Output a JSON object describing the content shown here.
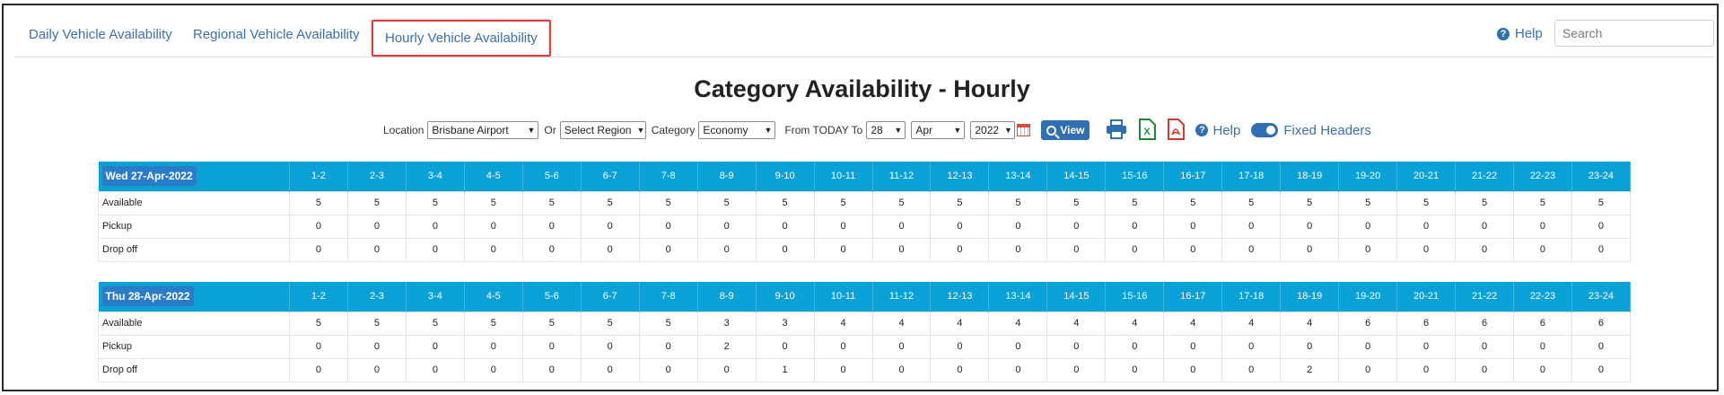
{
  "nav": {
    "tabs": [
      {
        "label": "Daily Vehicle Availability"
      },
      {
        "label": "Regional Vehicle Availability"
      },
      {
        "label": "Hourly Vehicle Availability"
      }
    ],
    "help_label": "Help",
    "search_placeholder": "Search"
  },
  "page_title": "Category Availability - Hourly",
  "filters": {
    "location_label": "Location",
    "location_value": "Brisbane Airport",
    "or_label": "Or",
    "region_value": "Select Region",
    "category_label": "Category",
    "category_value": "Economy",
    "from_label": "From TODAY To",
    "day_value": "28",
    "month_value": "Apr",
    "year_value": "2022",
    "view_label": "View",
    "help_label": "Help",
    "fixed_headers_label": "Fixed Headers",
    "fixed_headers_on": true
  },
  "hours": [
    "1-2",
    "2-3",
    "3-4",
    "4-5",
    "5-6",
    "6-7",
    "7-8",
    "8-9",
    "9-10",
    "10-11",
    "11-12",
    "12-13",
    "13-14",
    "14-15",
    "15-16",
    "16-17",
    "17-18",
    "18-19",
    "19-20",
    "20-21",
    "21-22",
    "22-23",
    "23-24"
  ],
  "days": [
    {
      "label": "Wed 27-Apr-2022",
      "rows": [
        {
          "label": "Available",
          "values": [
            "5",
            "5",
            "5",
            "5",
            "5",
            "5",
            "5",
            "5",
            "5",
            "5",
            "5",
            "5",
            "5",
            "5",
            "5",
            "5",
            "5",
            "5",
            "5",
            "5",
            "5",
            "5",
            "5"
          ]
        },
        {
          "label": "Pickup",
          "values": [
            "0",
            "0",
            "0",
            "0",
            "0",
            "0",
            "0",
            "0",
            "0",
            "0",
            "0",
            "0",
            "0",
            "0",
            "0",
            "0",
            "0",
            "0",
            "0",
            "0",
            "0",
            "0",
            "0"
          ]
        },
        {
          "label": "Drop off",
          "values": [
            "0",
            "0",
            "0",
            "0",
            "0",
            "0",
            "0",
            "0",
            "0",
            "0",
            "0",
            "0",
            "0",
            "0",
            "0",
            "0",
            "0",
            "0",
            "0",
            "0",
            "0",
            "0",
            "0"
          ]
        }
      ]
    },
    {
      "label": "Thu 28-Apr-2022",
      "rows": [
        {
          "label": "Available",
          "values": [
            "5",
            "5",
            "5",
            "5",
            "5",
            "5",
            "5",
            "3",
            "3",
            "4",
            "4",
            "4",
            "4",
            "4",
            "4",
            "4",
            "4",
            "4",
            "6",
            "6",
            "6",
            "6",
            "6"
          ]
        },
        {
          "label": "Pickup",
          "values": [
            "0",
            "0",
            "0",
            "0",
            "0",
            "0",
            "0",
            "2",
            "0",
            "0",
            "0",
            "0",
            "0",
            "0",
            "0",
            "0",
            "0",
            "0",
            "0",
            "0",
            "0",
            "0",
            "0"
          ]
        },
        {
          "label": "Drop off",
          "values": [
            "0",
            "0",
            "0",
            "0",
            "0",
            "0",
            "0",
            "0",
            "1",
            "0",
            "0",
            "0",
            "0",
            "0",
            "0",
            "0",
            "0",
            "2",
            "0",
            "0",
            "0",
            "0",
            "0"
          ]
        }
      ]
    }
  ],
  "colors": {
    "header_bg": "#0aa1d6",
    "day_pill": "#2a7cc7",
    "link": "#3d6fa8",
    "active_tab_border": "#e0393e"
  }
}
